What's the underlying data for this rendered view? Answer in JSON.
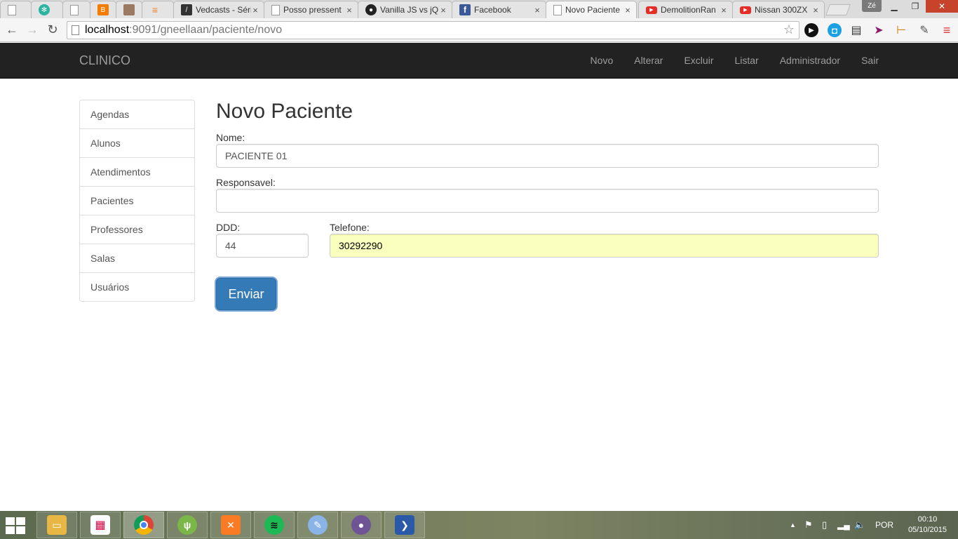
{
  "browser": {
    "tabs": [
      {
        "title": "",
        "icon": "document-icon",
        "active": false
      },
      {
        "title": "",
        "icon": "gear-flower-icon",
        "active": false
      },
      {
        "title": "",
        "icon": "document-icon",
        "active": false
      },
      {
        "title": "",
        "icon": "blogger-icon",
        "active": false
      },
      {
        "title": "",
        "icon": "profile-photo-icon",
        "active": false
      },
      {
        "title": "",
        "icon": "stackoverflow-icon",
        "active": false
      },
      {
        "title": "Vedcasts - Séri",
        "icon": "vedcasts-icon",
        "active": false
      },
      {
        "title": "Posso pressent",
        "icon": "document-icon",
        "active": false
      },
      {
        "title": "Vanilla JS vs jQ",
        "icon": "github-icon",
        "active": false
      },
      {
        "title": "Facebook",
        "icon": "facebook-icon",
        "active": false
      },
      {
        "title": "Novo Paciente",
        "icon": "document-icon",
        "active": true
      },
      {
        "title": "DemolitionRan",
        "icon": "youtube-icon",
        "active": false
      },
      {
        "title": "Nissan 300ZX",
        "icon": "youtube-icon",
        "active": false
      }
    ],
    "user_badge": "Zé",
    "url_host": "localhost",
    "url_rest": ":9091/gneellaan/paciente/novo"
  },
  "app": {
    "brand": "CLINICO",
    "nav": [
      "Novo",
      "Alterar",
      "Excluir",
      "Listar",
      "Administrador",
      "Sair"
    ],
    "sidebar": [
      "Agendas",
      "Alunos",
      "Atendimentos",
      "Pacientes",
      "Professores",
      "Salas",
      "Usuários"
    ]
  },
  "form": {
    "title": "Novo Paciente",
    "nome_label": "Nome:",
    "nome_value": "PACIENTE 01",
    "responsavel_label": "Responsavel:",
    "responsavel_value": "",
    "ddd_label": "DDD:",
    "ddd_value": "44",
    "telefone_label": "Telefone:",
    "telefone_value": "30292290",
    "submit_label": "Enviar"
  },
  "taskbar": {
    "apps": [
      "file-explorer-icon",
      "apps-grid-icon",
      "chrome-icon",
      "gimp-icon",
      "xampp-icon",
      "spotify-icon",
      "paint-icon",
      "github-desktop-icon",
      "powershell-icon"
    ],
    "language": "POR",
    "time": "00:10",
    "date": "05/10/2015"
  },
  "colors": {
    "navbar_bg": "#222222",
    "primary": "#337ab7",
    "autofill": "#faffbd"
  }
}
